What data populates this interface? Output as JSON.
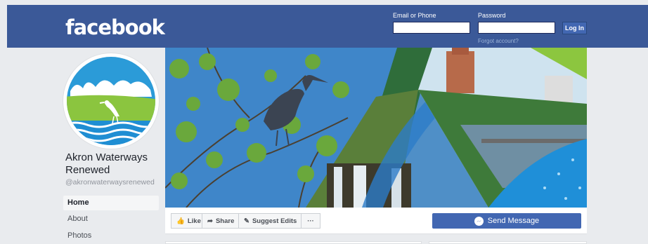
{
  "header": {
    "logo": "facebook",
    "email_label": "Email or Phone",
    "password_label": "Password",
    "login_label": "Log In",
    "forgot_label": "Forgot account?"
  },
  "page": {
    "name": "Akron Waterways Renewed",
    "handle": "@akronwaterwaysrenewed"
  },
  "nav": {
    "items": [
      {
        "label": "Home",
        "active": true
      },
      {
        "label": "About",
        "active": false
      },
      {
        "label": "Photos",
        "active": false
      }
    ]
  },
  "actions": {
    "like": "Like",
    "share": "Share",
    "suggest": "Suggest Edits",
    "more": "···",
    "send_message": "Send Message"
  },
  "colors": {
    "brand": "#3b5998",
    "button_blue": "#4267b2",
    "page_bg": "#e9ebee"
  }
}
